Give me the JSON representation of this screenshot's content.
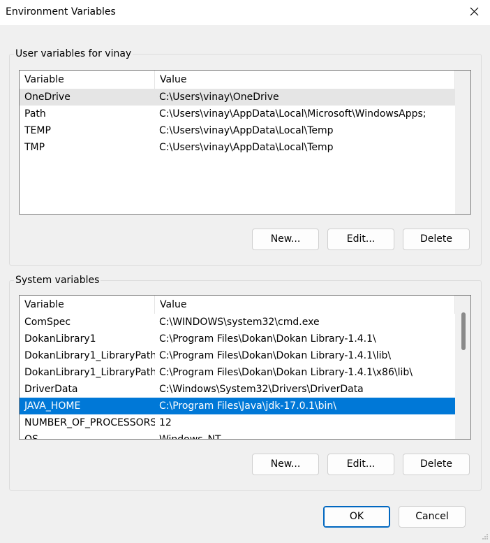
{
  "window": {
    "title": "Environment Variables"
  },
  "user_section": {
    "label": "User variables for vinay",
    "columns": [
      "Variable",
      "Value"
    ],
    "rows": [
      {
        "variable": "OneDrive",
        "value": "C:\\Users\\vinay\\OneDrive"
      },
      {
        "variable": "Path",
        "value": "C:\\Users\\vinay\\AppData\\Local\\Microsoft\\WindowsApps;"
      },
      {
        "variable": "TEMP",
        "value": "C:\\Users\\vinay\\AppData\\Local\\Temp"
      },
      {
        "variable": "TMP",
        "value": "C:\\Users\\vinay\\AppData\\Local\\Temp"
      }
    ],
    "buttons": {
      "new": "New...",
      "edit": "Edit...",
      "delete": "Delete"
    }
  },
  "system_section": {
    "label": "System variables",
    "columns": [
      "Variable",
      "Value"
    ],
    "rows": [
      {
        "variable": "ComSpec",
        "value": "C:\\WINDOWS\\system32\\cmd.exe"
      },
      {
        "variable": "DokanLibrary1",
        "value": "C:\\Program Files\\Dokan\\Dokan Library-1.4.1\\"
      },
      {
        "variable": "DokanLibrary1_LibraryPath...",
        "value": "C:\\Program Files\\Dokan\\Dokan Library-1.4.1\\lib\\"
      },
      {
        "variable": "DokanLibrary1_LibraryPath...",
        "value": "C:\\Program Files\\Dokan\\Dokan Library-1.4.1\\x86\\lib\\"
      },
      {
        "variable": "DriverData",
        "value": "C:\\Windows\\System32\\Drivers\\DriverData"
      },
      {
        "variable": "JAVA_HOME",
        "value": "C:\\Program Files\\Java\\jdk-17.0.1\\bin\\"
      },
      {
        "variable": "NUMBER_OF_PROCESSORS",
        "value": "12"
      },
      {
        "variable": "OS",
        "value": "Windows_NT"
      }
    ],
    "buttons": {
      "new": "New...",
      "edit": "Edit...",
      "delete": "Delete"
    }
  },
  "footer": {
    "ok": "OK",
    "cancel": "Cancel"
  },
  "colors": {
    "selection": "#0078d7",
    "hover": "#e5e5e5",
    "accent": "#0067c0"
  },
  "icons": {
    "close": "close-icon",
    "resize": "resize-grip-icon"
  }
}
